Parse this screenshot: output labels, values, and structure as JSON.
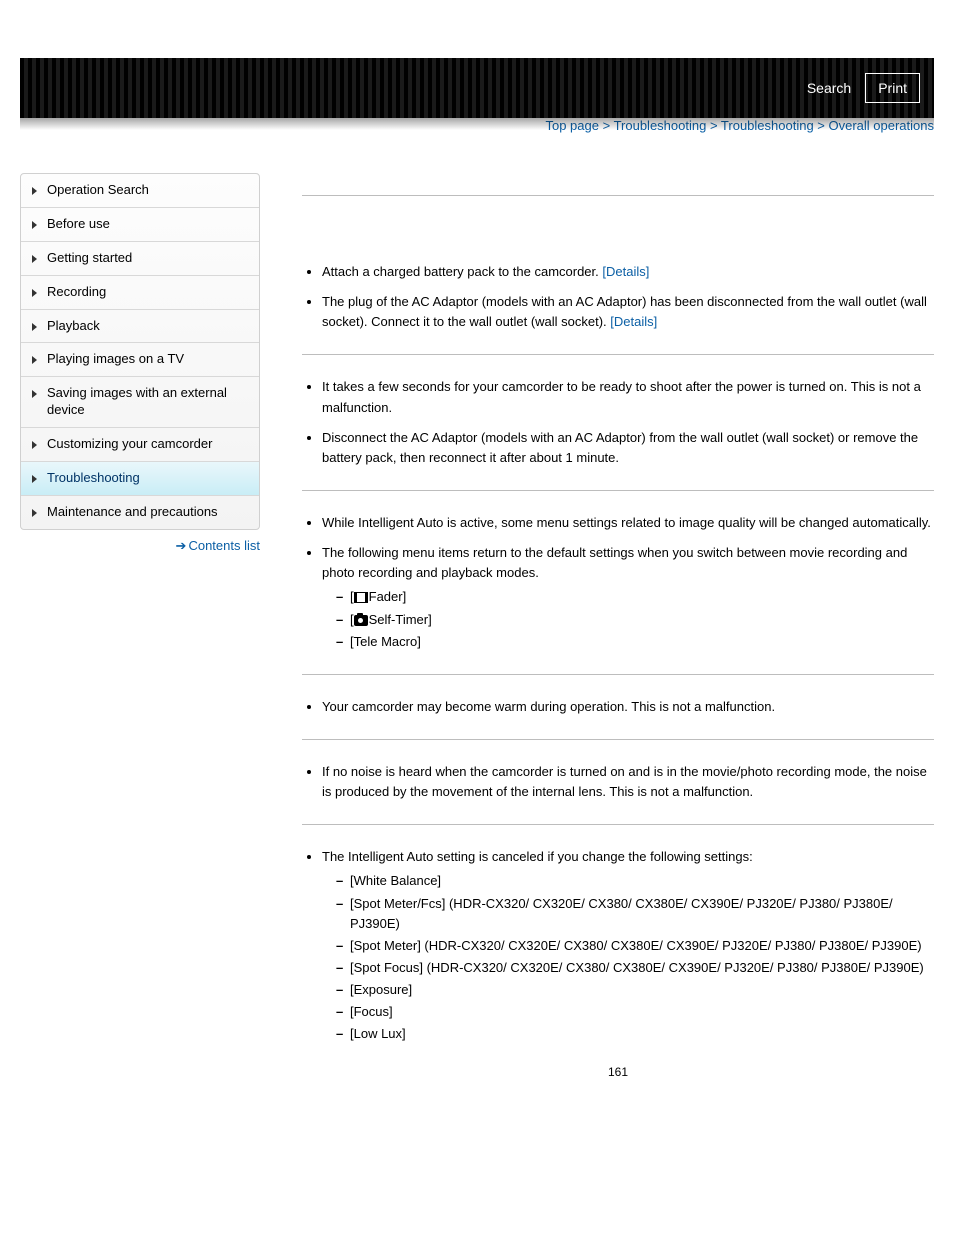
{
  "header": {
    "search": "Search",
    "print": "Print"
  },
  "breadcrumb": {
    "items": [
      "Top page",
      "Troubleshooting",
      "Troubleshooting",
      "Overall operations"
    ],
    "sep": ">"
  },
  "sidebar": {
    "items": [
      "Operation Search",
      "Before use",
      "Getting started",
      "Recording",
      "Playback",
      "Playing images on a TV",
      "Saving images with an external device",
      "Customizing your camcorder",
      "Troubleshooting",
      "Maintenance and precautions"
    ],
    "active_index": 8,
    "contents_list": "Contents list"
  },
  "sections": [
    {
      "bullets": [
        {
          "text": "Attach a charged battery pack to the camcorder.",
          "details": true
        },
        {
          "text": "The plug of the AC Adaptor (models with an AC Adaptor) has been disconnected from the wall outlet (wall socket). Connect it to the wall outlet (wall socket).",
          "details": true
        }
      ]
    },
    {
      "bullets": [
        {
          "text": "It takes a few seconds for your camcorder to be ready to shoot after the power is turned on. This is not a malfunction."
        },
        {
          "text": "Disconnect the AC Adaptor (models with an AC Adaptor) from the wall outlet (wall socket) or remove the battery pack, then reconnect it after about 1 minute."
        }
      ]
    },
    {
      "bullets": [
        {
          "text": "While Intelligent Auto is active, some menu settings related to image quality will be changed automatically."
        },
        {
          "text": "The following menu items return to the default settings when you switch between movie recording and photo recording and playback modes.",
          "sub": [
            {
              "icon": "film",
              "label": "Fader"
            },
            {
              "icon": "cam",
              "label": "Self-Timer"
            },
            {
              "label": "Tele Macro"
            }
          ]
        }
      ]
    },
    {
      "bullets": [
        {
          "text": "Your camcorder may become warm during operation. This is not a malfunction."
        }
      ]
    },
    {
      "bullets": [
        {
          "text": "If no noise is heard when the camcorder is turned on and is in the movie/photo recording mode, the noise is produced by the movement of the internal lens. This is not a malfunction."
        }
      ]
    },
    {
      "bullets": [
        {
          "text": "The Intelligent Auto setting is canceled if you change the following settings:",
          "sub": [
            {
              "label": "White Balance"
            },
            {
              "label": "Spot Meter/Fcs] (HDR-CX320/ CX320E/ CX380/ CX380E/ CX390E/ PJ320E/ PJ380/ PJ380E/ PJ390E)",
              "raw": true,
              "pre": "["
            },
            {
              "label": "Spot Meter] (HDR-CX320/ CX320E/ CX380/ CX380E/ CX390E/ PJ320E/ PJ380/ PJ380E/ PJ390E)",
              "raw": true,
              "pre": "["
            },
            {
              "label": "Spot Focus] (HDR-CX320/ CX320E/ CX380/ CX380E/ CX390E/ PJ320E/ PJ380/ PJ380E/ PJ390E)",
              "raw": true,
              "pre": "["
            },
            {
              "label": "Exposure"
            },
            {
              "label": "Focus"
            },
            {
              "label": "Low Lux"
            }
          ]
        }
      ]
    }
  ],
  "details_label": "[Details]",
  "page_number": "161"
}
